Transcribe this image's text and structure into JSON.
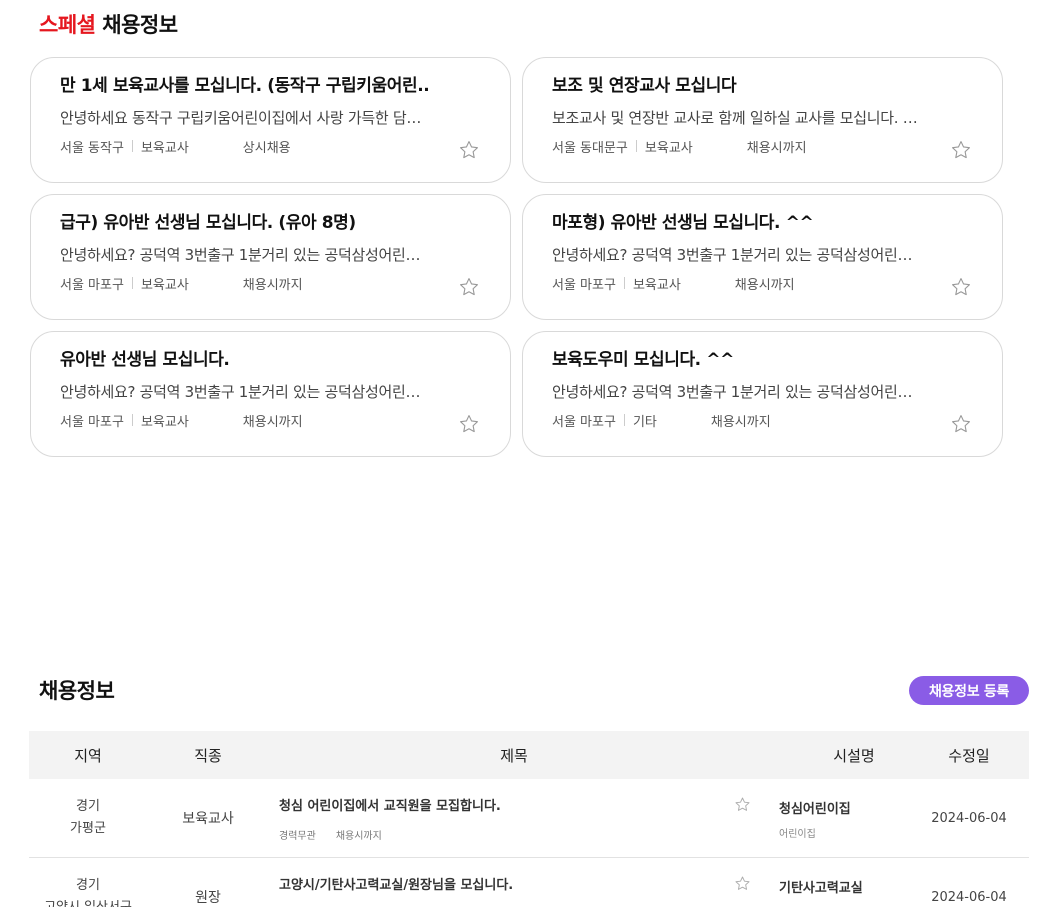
{
  "special": {
    "title_accent": "스페셜",
    "title_rest": "채용정보",
    "cards": [
      {
        "title": "만 1세 보육교사를 모십니다. (동작구 구립키움어린..",
        "desc": "안녕하세요 동작구 구립키움어린이집에서 사랑 가득한 담…",
        "location": "서울 동작구",
        "job": "보육교사",
        "term": "상시채용"
      },
      {
        "title": "보조 및 연장교사 모십니다",
        "desc": "보조교사 및 연장반 교사로 함께 일하실 교사를 모십니다. …",
        "location": "서울 동대문구",
        "job": "보육교사",
        "term": "채용시까지"
      },
      {
        "title": "급구) 유아반 선생님 모십니다. (유아 8명)",
        "desc": "안녕하세요? 공덕역 3번출구 1분거리 있는 공덕삼성어린…",
        "location": "서울 마포구",
        "job": "보육교사",
        "term": "채용시까지"
      },
      {
        "title": "마포형) 유아반 선생님 모십니다. ^^",
        "desc": "안녕하세요? 공덕역 3번출구 1분거리 있는 공덕삼성어린…",
        "location": "서울 마포구",
        "job": "보육교사",
        "term": "채용시까지"
      },
      {
        "title": "유아반 선생님 모십니다.",
        "desc": "안녕하세요? 공덕역 3번출구 1분거리 있는 공덕삼성어린…",
        "location": "서울 마포구",
        "job": "보육교사",
        "term": "채용시까지"
      },
      {
        "title": "보육도우미 모십니다. ^^",
        "desc": "안녕하세요? 공덕역 3번출구 1분거리 있는 공덕삼성어린…",
        "location": "서울 마포구",
        "job": "기타",
        "term": "채용시까지"
      }
    ]
  },
  "jobs": {
    "title": "채용정보",
    "register_label": "채용정보 등록",
    "headers": {
      "region": "지역",
      "job": "직종",
      "title": "제목",
      "facility": "시설명",
      "date": "수정일"
    },
    "rows": [
      {
        "region1": "경기",
        "region2": "가평군",
        "job": "보육교사",
        "title": "청심 어린이집에서 교직원을 모집합니다.",
        "career": "경력무관",
        "term": "채용시까지",
        "facility": "청심어린이집",
        "facility_type": "어린이집",
        "date": "2024-06-04"
      },
      {
        "region1": "경기",
        "region2": "고양시 일산서구",
        "job": "원장",
        "title": "고양시/기탄사고력교실/원장님을 모십니다.",
        "career": "",
        "term": "",
        "facility": "기탄사고력교실",
        "facility_type": "",
        "date": "2024-06-04"
      }
    ]
  },
  "icons": {
    "star": "star-outline-icon"
  },
  "colors": {
    "accent_red": "#e5171f",
    "register_purple": "#8a5ce6",
    "header_bg": "#f3f3f3"
  }
}
